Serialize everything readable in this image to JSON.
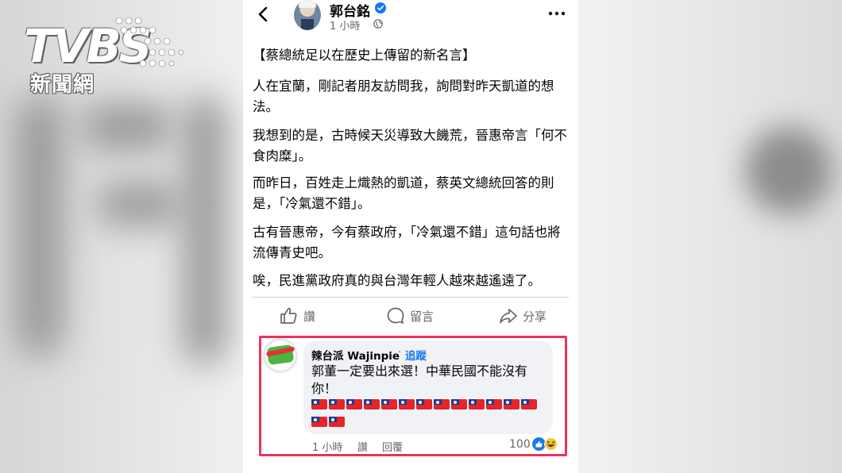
{
  "watermark": {
    "brand": "TVBS",
    "sub": "新聞網"
  },
  "post": {
    "author": "郭台銘",
    "time": "1 小時",
    "paragraphs": [
      "【蔡總統足以在歷史上傳留的新名言】",
      "人在宜蘭，剛記者朋友訪問我，詢問對昨天凱道的想法。",
      "我想到的是，古時候天災導致大饑荒，晉惠帝言「何不食肉糜」。",
      "而昨日，百姓走上熾熱的凱道，蔡英文總統回答的則是，「冷氣還不錯」。",
      "古有晉惠帝，今有蔡政府，「冷氣還不錯」這句話也將流傳青史吧。",
      "唉，民進黨政府真的與台灣年輕人越來越遙遠了。"
    ],
    "actions": {
      "like": "讚",
      "comment": "留言",
      "share": "分享"
    }
  },
  "comment": {
    "author": "辣台派 Wajinpie",
    "dot": "·",
    "follow": "追蹤",
    "text": "郭董一定要出來選！中華民國不能沒有你！",
    "flag_count": 15,
    "time": "1 小時",
    "like": "讚",
    "reply": "回覆",
    "reactions": "100"
  },
  "colors": {
    "highlight": "#e8355a",
    "link": "#1877f2"
  },
  "icons": [
    "back-arrow-icon",
    "verified-badge-icon",
    "globe-icon",
    "more-options-icon",
    "thumbs-up-icon",
    "comment-bubble-icon",
    "share-arrow-icon",
    "taiwan-flag-icon",
    "like-reaction-icon",
    "haha-reaction-icon"
  ]
}
